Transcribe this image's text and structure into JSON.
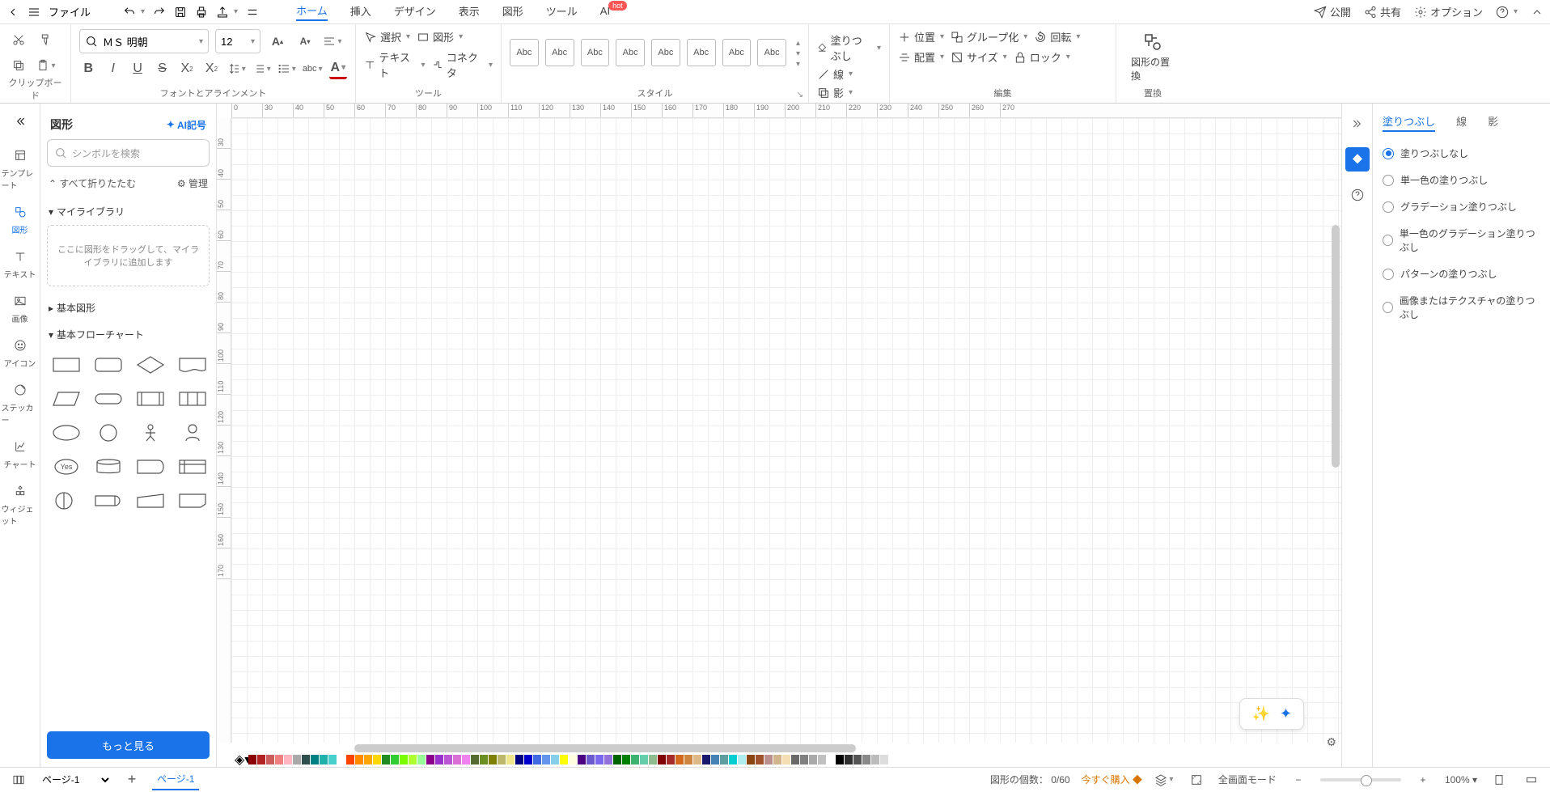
{
  "menubar": {
    "file": "ファイル",
    "tabs": [
      "ホーム",
      "挿入",
      "デザイン",
      "表示",
      "図形",
      "ツール",
      "AI"
    ],
    "active_tab": 0,
    "hot": "hot",
    "publish": "公開",
    "share": "共有",
    "options": "オプション"
  },
  "ribbon": {
    "clipboard_label": "クリップボード",
    "font_name": "ＭＳ 明朝",
    "font_size": "12",
    "font_label": "フォントとアラインメント",
    "select": "選択",
    "text": "テキスト",
    "shape": "図形",
    "connector": "コネクタ",
    "tool_label": "ツール",
    "style_label": "スタイル",
    "style_sample": "Abc",
    "fill": "塗りつぶし",
    "line": "線",
    "shadow": "影",
    "position": "位置",
    "align": "配置",
    "group": "グループ化",
    "size": "サイズ",
    "rotate": "回転",
    "lock": "ロック",
    "edit_label": "編集",
    "replace_shape": "図形の置換",
    "replace_label": "置換"
  },
  "rail": {
    "items": [
      "テンプレート",
      "図形",
      "テキスト",
      "画像",
      "アイコン",
      "ステッカー",
      "チャート",
      "ウィジェット"
    ],
    "active": 1
  },
  "shapes": {
    "title": "図形",
    "ai_symbol": "AI記号",
    "search_placeholder": "シンボルを検索",
    "collapse_all": "すべて折りたたむ",
    "manage": "管理",
    "my_library": "マイライブラリ",
    "dropzone": "ここに図形をドラッグして、マイライブラリに追加します",
    "basic_shapes": "基本図形",
    "basic_flowchart": "基本フローチャート",
    "yes": "Yes",
    "more": "もっと見る"
  },
  "ruler_h": [
    "0",
    "30",
    "40",
    "50",
    "60",
    "70",
    "80",
    "90",
    "100",
    "110",
    "120",
    "130",
    "140",
    "150",
    "160",
    "170",
    "180",
    "190",
    "200",
    "210",
    "220",
    "230",
    "240",
    "250",
    "260",
    "270"
  ],
  "ruler_v": [
    "30",
    "40",
    "50",
    "60",
    "70",
    "80",
    "90",
    "100",
    "110",
    "120",
    "130",
    "140",
    "150",
    "160",
    "170"
  ],
  "right_panel": {
    "tabs": [
      "塗りつぶし",
      "線",
      "影"
    ],
    "active": 0,
    "options": [
      "塗りつぶしなし",
      "単一色の塗りつぶし",
      "グラデーション塗りつぶし",
      "単一色のグラデーション塗りつぶし",
      "パターンの塗りつぶし",
      "画像またはテクスチャの塗りつぶし"
    ],
    "selected": 0
  },
  "color_swatches": [
    "#8b0000",
    "#b22222",
    "#cd5c5c",
    "#f08080",
    "#ffb6c1",
    "#a9a9a9",
    "#2f4f4f",
    "#008080",
    "#20b2aa",
    "#48d1cc",
    "#ffffff",
    "#ff4500",
    "#ff8c00",
    "#ffa500",
    "#ffd700",
    "#228b22",
    "#32cd32",
    "#7cfc00",
    "#adff2f",
    "#98fb98",
    "#8b008b",
    "#9932cc",
    "#ba55d3",
    "#da70d6",
    "#ee82ee",
    "#556b2f",
    "#6b8e23",
    "#808000",
    "#bdb76b",
    "#f0e68c",
    "#000080",
    "#0000cd",
    "#4169e1",
    "#6495ed",
    "#87ceeb",
    "#ffff00",
    "#ffffe0",
    "#4b0082",
    "#6a5acd",
    "#7b68ee",
    "#9370db",
    "#006400",
    "#008000",
    "#3cb371",
    "#66cdaa",
    "#8fbc8f",
    "#800000",
    "#a52a2a",
    "#d2691e",
    "#cd853f",
    "#deb887",
    "#191970",
    "#4682b4",
    "#5f9ea0",
    "#00ced1",
    "#afeeee",
    "#8b4513",
    "#a0522d",
    "#bc8f8f",
    "#d2b48c",
    "#f5deb3",
    "#696969",
    "#808080",
    "#a9a9a9",
    "#c0c0c0",
    "#ffffff",
    "#000000",
    "#2f2f2f",
    "#555555",
    "#888888",
    "#bbbbbb",
    "#dddddd"
  ],
  "statusbar": {
    "page_dd": "ページ-1",
    "page_tab": "ページ-1",
    "shape_count_label": "図形の個数：",
    "shape_count": "0/60",
    "buy_now": "今すぐ購入",
    "fullscreen": "全画面モード",
    "zoom": "100%"
  }
}
